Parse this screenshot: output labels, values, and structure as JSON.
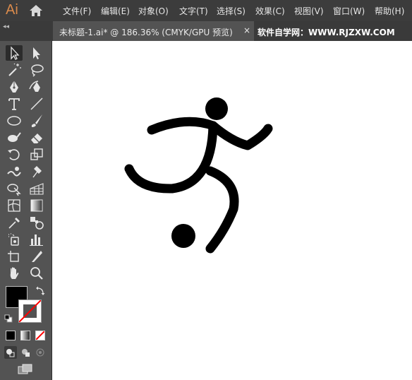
{
  "app": {
    "logo": "Ai"
  },
  "menu": [
    {
      "label": "文件(F)"
    },
    {
      "label": "编辑(E)"
    },
    {
      "label": "对象(O)"
    },
    {
      "label": "文字(T)"
    },
    {
      "label": "选择(S)"
    },
    {
      "label": "效果(C)"
    },
    {
      "label": "视图(V)"
    },
    {
      "label": "窗口(W)"
    },
    {
      "label": "帮助(H)"
    }
  ],
  "tabs": {
    "collapse_glyph": "◂◂",
    "active_title": "未标题-1.ai* @ 186.36% (CMYK/GPU 预览)",
    "close_glyph": "×",
    "watermark": "软件自学网：WWW.RJZXW.COM"
  },
  "colors": {
    "menubar": "#3c3c3c",
    "panel": "#535353",
    "fill_swatch": "#000000",
    "stroke_none": "#ff0000",
    "artwork": "#000000",
    "logo": "#d98a4c"
  },
  "tools": [
    "selection-tool-icon",
    "direct-selection-tool-icon",
    "magic-wand-tool-icon",
    "lasso-tool-icon",
    "pen-tool-icon",
    "curvature-tool-icon",
    "type-tool-icon",
    "line-segment-tool-icon",
    "ellipse-tool-icon",
    "paintbrush-tool-icon",
    "shaper-tool-icon",
    "eraser-tool-icon",
    "rotate-tool-icon",
    "scale-tool-icon",
    "warp-tool-icon",
    "puppet-warp-tool-icon",
    "shape-builder-tool-icon",
    "perspective-grid-tool-icon",
    "mesh-tool-icon",
    "gradient-tool-icon",
    "eyedropper-tool-icon",
    "blend-tool-icon",
    "symbol-sprayer-tool-icon",
    "column-graph-tool-icon",
    "artboard-tool-icon",
    "slice-tool-icon",
    "hand-tool-icon",
    "zoom-tool-icon"
  ]
}
